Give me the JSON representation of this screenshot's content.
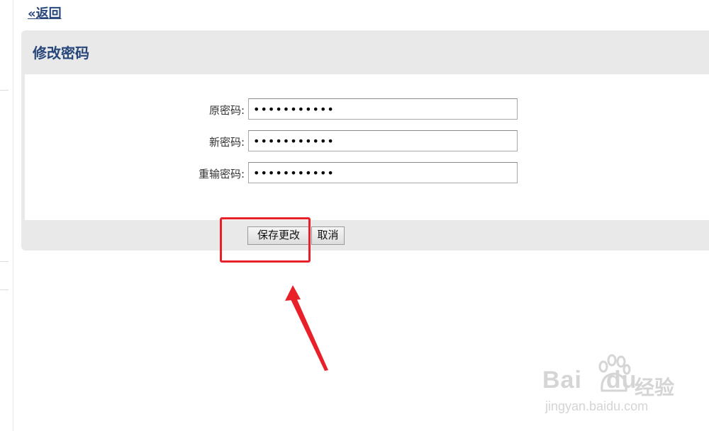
{
  "nav": {
    "back_label": "«返回"
  },
  "panel": {
    "title": "修改密码"
  },
  "form": {
    "fields": [
      {
        "label": "原密码:",
        "masked_value": "•••••••••••"
      },
      {
        "label": "新密码:",
        "masked_value": "•••••••••••"
      },
      {
        "label": "重输密码:",
        "masked_value": "•••••••••••"
      }
    ]
  },
  "actions": {
    "save_label": "保存更改",
    "cancel_label": "取消"
  },
  "annotation": {
    "highlight_color": "#e8202a"
  },
  "watermark": {
    "brand": "Bai",
    "brand2": "du",
    "suffix": "经验",
    "url": "jingyan.baidu.com"
  },
  "colors": {
    "link": "#27467a",
    "panel_bg": "#e9e9e9"
  }
}
